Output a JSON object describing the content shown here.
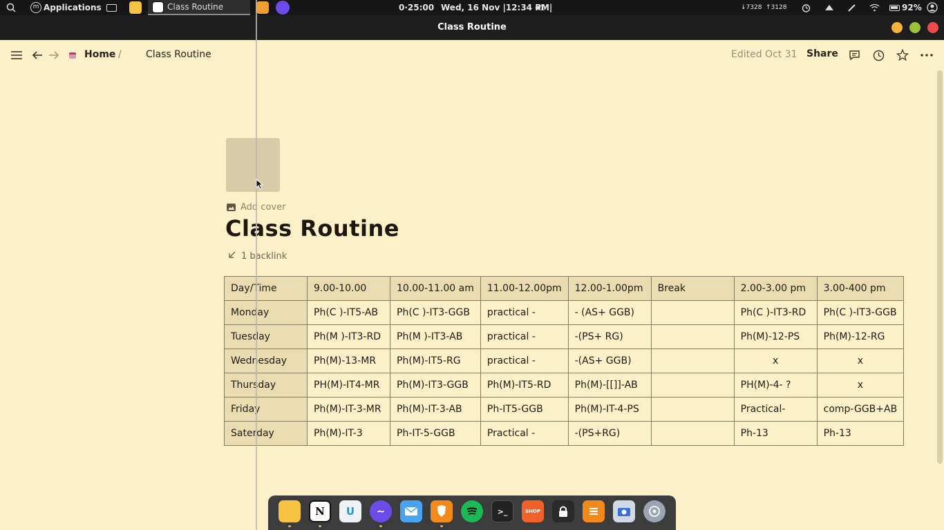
{
  "topbar": {
    "apps_label": "Applications",
    "active_task": "Class Routine",
    "timer": "0·25:00",
    "datetime": "Wed, 16 Nov |12:34 PM|",
    "net_down": "↓7328",
    "net_up": "↑3128",
    "battery": "92%"
  },
  "window": {
    "title": "Class Routine"
  },
  "header": {
    "breadcrumb_home": "Home",
    "breadcrumb_sep": "/",
    "breadcrumb_current": "Class Routine",
    "edited": "Edited Oct 31",
    "share": "Share"
  },
  "page": {
    "add_cover": "Add cover",
    "title": "Class Routine",
    "backlink": "1 backlink"
  },
  "table": {
    "headers": [
      "Day/Time",
      "9.00-10.00",
      "10.00-11.00 am",
      "11.00-12.00pm",
      "12.00-1.00pm",
      "Break",
      "2.00-3.00 pm",
      "3.00-400 pm"
    ],
    "rows": [
      [
        "Monday",
        "Ph(C )-IT5-AB",
        "Ph(C )-IT3-GGB",
        "practical -",
        "- (AS+ GGB)",
        "",
        "Ph(C )-IT3-RD",
        "Ph(C )-IT3-GGB"
      ],
      [
        "Tuesday",
        "Ph(M )-IT3-RD",
        "Ph(M )-IT3-AB",
        "practical -",
        "-(PS+ RG)",
        "",
        "Ph(M)-12-PS",
        "Ph(M)-12-RG"
      ],
      [
        "Wednesday",
        "Ph(M)-13-MR",
        "Ph(M)-IT5-RG",
        "practical -",
        "-(AS+ GGB)",
        "",
        "x",
        "x"
      ],
      [
        "Thursday",
        "PH(M)-IT4-MR",
        "Ph(M)-IT3-GGB",
        "Ph(M)-IT5-RD",
        "Ph(M)-[[]]-AB",
        "",
        "PH(M)-4- ?",
        "x"
      ],
      [
        "Friday",
        "Ph(M)-IT-3-MR",
        "Ph(M)-IT-3-AB",
        "Ph-IT5-GGB",
        "Ph(M)-IT-4-PS",
        "",
        "Practical-",
        "comp-GGB+AB"
      ],
      [
        "Saterday",
        "Ph(M)-IT-3",
        "Ph-IT-5-GGB",
        "Practical -",
        "-(PS+RG)",
        "",
        "Ph-13",
        "Ph-13"
      ]
    ]
  },
  "dock": {
    "notion_letter": "N",
    "upnote_letter": "U",
    "terminal_label": ">_",
    "shop_label": "SHOP"
  }
}
